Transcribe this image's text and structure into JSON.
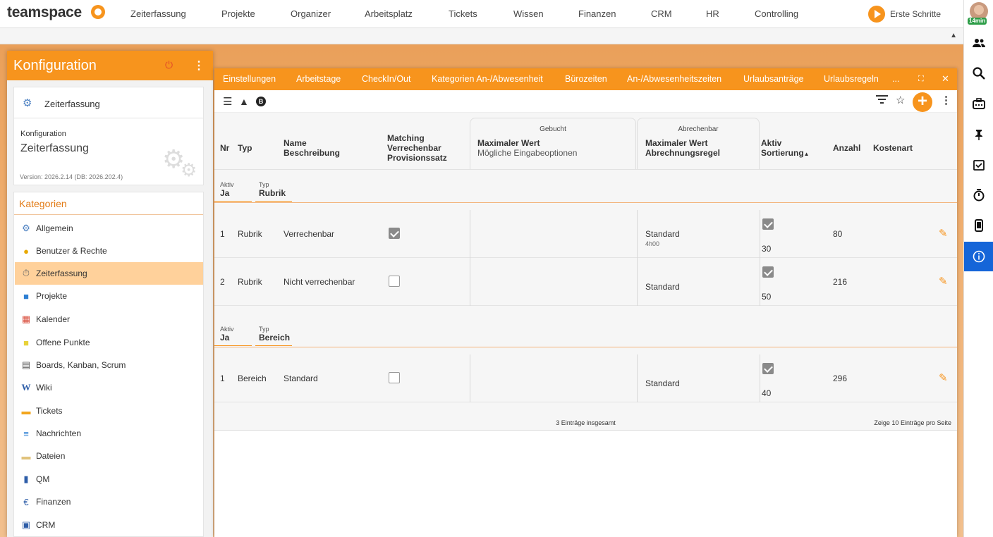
{
  "topnav": {
    "logo": "teamspace",
    "items": [
      "Zeiterfassung",
      "Projekte",
      "Organizer",
      "Arbeitsplatz",
      "Tickets",
      "Wissen",
      "Finanzen",
      "CRM",
      "HR",
      "Controlling"
    ],
    "first_steps": "Erste Schritte",
    "timer_badge": "14min"
  },
  "panel": {
    "title": "Konfiguration",
    "module": "Zeiterfassung",
    "config_label": "Konfiguration",
    "config_value": "Zeiterfassung",
    "version": "Version: 2026.2.14 (DB: 2026.202.4)",
    "categories_title": "Kategorien",
    "categories": [
      "Allgemein",
      "Benutzer & Rechte",
      "Zeiterfassung",
      "Projekte",
      "Kalender",
      "Offene Punkte",
      "Boards, Kanban, Scrum",
      "Wiki",
      "Tickets",
      "Nachrichten",
      "Dateien",
      "QM",
      "Finanzen",
      "CRM"
    ],
    "selected_category": "Zeiterfassung"
  },
  "tabs": [
    "Einstellungen",
    "Arbeitstage",
    "CheckIn/Out",
    "Kategorien An-/Abwesenheit",
    "Bürozeiten",
    "An-/Abwesenheitszeiten",
    "Urlaubsanträge",
    "Urlaubsregeln",
    "..."
  ],
  "table": {
    "group_booked": "Gebucht",
    "group_billable": "Abrechenbar",
    "headers": {
      "nr": "Nr",
      "typ": "Typ",
      "name": "Name",
      "beschreibung": "Beschreibung",
      "matching": "Matching",
      "verrechenbar": "Verrechenbar",
      "provisionssatz": "Provisionssatz",
      "max_wert_1": "Maximaler Wert",
      "eingabeoptionen": "Mögliche Eingabeoptionen",
      "max_wert_2": "Maximaler Wert",
      "abrechnungsregel": "Abrechnungsregel",
      "aktiv": "Aktiv",
      "sortierung": "Sortierung",
      "anzahl": "Anzahl",
      "kostenart": "Kostenart"
    },
    "groups": [
      {
        "aktiv_label": "Aktiv",
        "aktiv_value": "Ja",
        "typ_label": "Typ",
        "typ_value": "Rubrik",
        "rows": [
          {
            "nr": "1",
            "typ": "Rubrik",
            "name": "Verrechenbar",
            "verrechenbar": true,
            "abrechnung": "Standard",
            "abrechnung_sub": "4h00",
            "aktiv": true,
            "sortierung": "30",
            "anzahl": "80"
          },
          {
            "nr": "2",
            "typ": "Rubrik",
            "name": "Nicht verrechenbar",
            "verrechenbar": false,
            "abrechnung": "Standard",
            "abrechnung_sub": "",
            "aktiv": true,
            "sortierung": "50",
            "anzahl": "216"
          }
        ]
      },
      {
        "aktiv_label": "Aktiv",
        "aktiv_value": "Ja",
        "typ_label": "Typ",
        "typ_value": "Bereich",
        "rows": [
          {
            "nr": "1",
            "typ": "Bereich",
            "name": "Standard",
            "verrechenbar": false,
            "abrechnung": "Standard",
            "abrechnung_sub": "",
            "aktiv": true,
            "sortierung": "40",
            "anzahl": "296"
          }
        ]
      }
    ],
    "total": "3 Einträge insgesamt",
    "page_size_prefix": "Zeige",
    "page_size": "10",
    "page_size_suffix": "Einträge pro Seite"
  }
}
